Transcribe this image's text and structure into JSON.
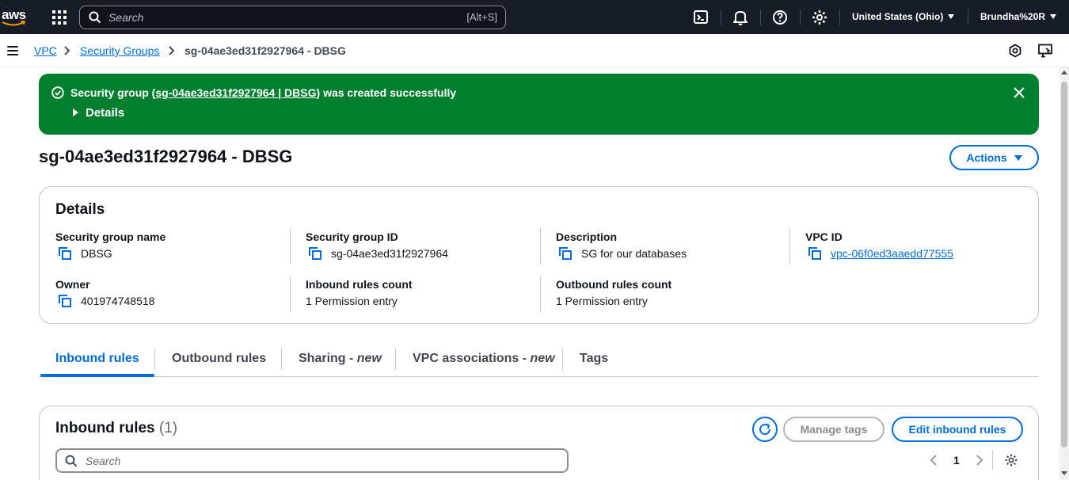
{
  "topnav": {
    "logo_text": "aws",
    "search_placeholder": "Search",
    "search_shortcut": "[Alt+S]",
    "region": "United States (Ohio)",
    "user": "Brundha%20R",
    "icons": [
      "services-grid-icon",
      "cloudshell-icon",
      "bell-icon",
      "help-icon",
      "gear-icon"
    ]
  },
  "breadcrumb": {
    "items": [
      "VPC",
      "Security Groups"
    ],
    "current": "sg-04ae3ed31f2927964 - DBSG"
  },
  "flash": {
    "prefix": "Security group (",
    "link": "sg-04ae3ed31f2927964 | DBSG",
    "suffix": ") was created successfully",
    "details_label": "Details",
    "color": "#00802f"
  },
  "page": {
    "title": "sg-04ae3ed31f2927964 - DBSG",
    "actions_label": "Actions"
  },
  "details": {
    "heading": "Details",
    "fields": {
      "sg_name": {
        "label": "Security group name",
        "value": "DBSG"
      },
      "sg_id": {
        "label": "Security group ID",
        "value": "sg-04ae3ed31f2927964"
      },
      "description": {
        "label": "Description",
        "value": "SG for our databases"
      },
      "vpc_id": {
        "label": "VPC ID",
        "value": "vpc-06f0ed3aaedd77555"
      },
      "owner": {
        "label": "Owner",
        "value": "401974748518"
      },
      "inbound_count": {
        "label": "Inbound rules count",
        "value": "1 Permission entry"
      },
      "outbound_count": {
        "label": "Outbound rules count",
        "value": "1 Permission entry"
      }
    }
  },
  "tabs": {
    "inbound": "Inbound rules",
    "outbound": "Outbound rules",
    "sharing": "Sharing - ",
    "sharing_badge": "new",
    "vpc_assoc": "VPC associations - ",
    "vpc_assoc_badge": "new",
    "tags": "Tags"
  },
  "inbound_panel": {
    "heading": "Inbound rules",
    "count": "(1)",
    "manage_tags_label": "Manage tags",
    "edit_label": "Edit inbound rules",
    "search_placeholder": "Search",
    "page_number": "1"
  },
  "colors": {
    "accent": "#006ce0",
    "nav_bg": "#161d26",
    "success": "#00802f"
  }
}
